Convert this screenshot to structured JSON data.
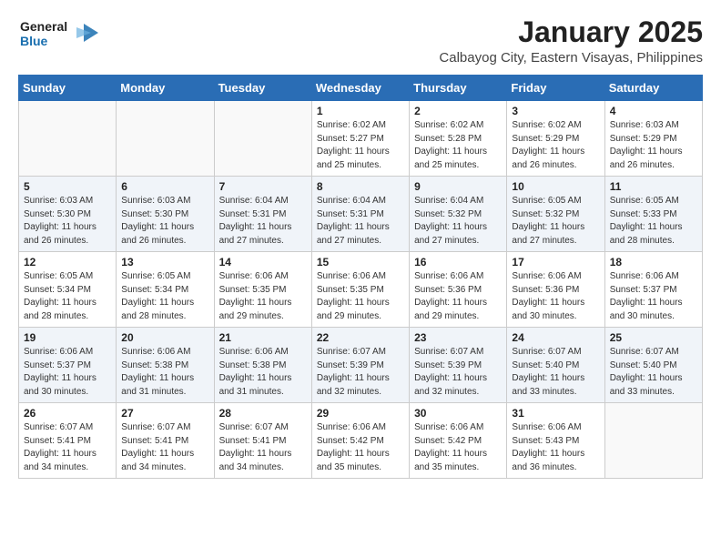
{
  "logo": {
    "line1": "General",
    "line2": "Blue"
  },
  "title": "January 2025",
  "subtitle": "Calbayog City, Eastern Visayas, Philippines",
  "days_of_week": [
    "Sunday",
    "Monday",
    "Tuesday",
    "Wednesday",
    "Thursday",
    "Friday",
    "Saturday"
  ],
  "weeks": [
    [
      {
        "day": "",
        "info": ""
      },
      {
        "day": "",
        "info": ""
      },
      {
        "day": "",
        "info": ""
      },
      {
        "day": "1",
        "info": "Sunrise: 6:02 AM\nSunset: 5:27 PM\nDaylight: 11 hours\nand 25 minutes."
      },
      {
        "day": "2",
        "info": "Sunrise: 6:02 AM\nSunset: 5:28 PM\nDaylight: 11 hours\nand 25 minutes."
      },
      {
        "day": "3",
        "info": "Sunrise: 6:02 AM\nSunset: 5:29 PM\nDaylight: 11 hours\nand 26 minutes."
      },
      {
        "day": "4",
        "info": "Sunrise: 6:03 AM\nSunset: 5:29 PM\nDaylight: 11 hours\nand 26 minutes."
      }
    ],
    [
      {
        "day": "5",
        "info": "Sunrise: 6:03 AM\nSunset: 5:30 PM\nDaylight: 11 hours\nand 26 minutes."
      },
      {
        "day": "6",
        "info": "Sunrise: 6:03 AM\nSunset: 5:30 PM\nDaylight: 11 hours\nand 26 minutes."
      },
      {
        "day": "7",
        "info": "Sunrise: 6:04 AM\nSunset: 5:31 PM\nDaylight: 11 hours\nand 27 minutes."
      },
      {
        "day": "8",
        "info": "Sunrise: 6:04 AM\nSunset: 5:31 PM\nDaylight: 11 hours\nand 27 minutes."
      },
      {
        "day": "9",
        "info": "Sunrise: 6:04 AM\nSunset: 5:32 PM\nDaylight: 11 hours\nand 27 minutes."
      },
      {
        "day": "10",
        "info": "Sunrise: 6:05 AM\nSunset: 5:32 PM\nDaylight: 11 hours\nand 27 minutes."
      },
      {
        "day": "11",
        "info": "Sunrise: 6:05 AM\nSunset: 5:33 PM\nDaylight: 11 hours\nand 28 minutes."
      }
    ],
    [
      {
        "day": "12",
        "info": "Sunrise: 6:05 AM\nSunset: 5:34 PM\nDaylight: 11 hours\nand 28 minutes."
      },
      {
        "day": "13",
        "info": "Sunrise: 6:05 AM\nSunset: 5:34 PM\nDaylight: 11 hours\nand 28 minutes."
      },
      {
        "day": "14",
        "info": "Sunrise: 6:06 AM\nSunset: 5:35 PM\nDaylight: 11 hours\nand 29 minutes."
      },
      {
        "day": "15",
        "info": "Sunrise: 6:06 AM\nSunset: 5:35 PM\nDaylight: 11 hours\nand 29 minutes."
      },
      {
        "day": "16",
        "info": "Sunrise: 6:06 AM\nSunset: 5:36 PM\nDaylight: 11 hours\nand 29 minutes."
      },
      {
        "day": "17",
        "info": "Sunrise: 6:06 AM\nSunset: 5:36 PM\nDaylight: 11 hours\nand 30 minutes."
      },
      {
        "day": "18",
        "info": "Sunrise: 6:06 AM\nSunset: 5:37 PM\nDaylight: 11 hours\nand 30 minutes."
      }
    ],
    [
      {
        "day": "19",
        "info": "Sunrise: 6:06 AM\nSunset: 5:37 PM\nDaylight: 11 hours\nand 30 minutes."
      },
      {
        "day": "20",
        "info": "Sunrise: 6:06 AM\nSunset: 5:38 PM\nDaylight: 11 hours\nand 31 minutes."
      },
      {
        "day": "21",
        "info": "Sunrise: 6:06 AM\nSunset: 5:38 PM\nDaylight: 11 hours\nand 31 minutes."
      },
      {
        "day": "22",
        "info": "Sunrise: 6:07 AM\nSunset: 5:39 PM\nDaylight: 11 hours\nand 32 minutes."
      },
      {
        "day": "23",
        "info": "Sunrise: 6:07 AM\nSunset: 5:39 PM\nDaylight: 11 hours\nand 32 minutes."
      },
      {
        "day": "24",
        "info": "Sunrise: 6:07 AM\nSunset: 5:40 PM\nDaylight: 11 hours\nand 33 minutes."
      },
      {
        "day": "25",
        "info": "Sunrise: 6:07 AM\nSunset: 5:40 PM\nDaylight: 11 hours\nand 33 minutes."
      }
    ],
    [
      {
        "day": "26",
        "info": "Sunrise: 6:07 AM\nSunset: 5:41 PM\nDaylight: 11 hours\nand 34 minutes."
      },
      {
        "day": "27",
        "info": "Sunrise: 6:07 AM\nSunset: 5:41 PM\nDaylight: 11 hours\nand 34 minutes."
      },
      {
        "day": "28",
        "info": "Sunrise: 6:07 AM\nSunset: 5:41 PM\nDaylight: 11 hours\nand 34 minutes."
      },
      {
        "day": "29",
        "info": "Sunrise: 6:06 AM\nSunset: 5:42 PM\nDaylight: 11 hours\nand 35 minutes."
      },
      {
        "day": "30",
        "info": "Sunrise: 6:06 AM\nSunset: 5:42 PM\nDaylight: 11 hours\nand 35 minutes."
      },
      {
        "day": "31",
        "info": "Sunrise: 6:06 AM\nSunset: 5:43 PM\nDaylight: 11 hours\nand 36 minutes."
      },
      {
        "day": "",
        "info": ""
      }
    ]
  ]
}
